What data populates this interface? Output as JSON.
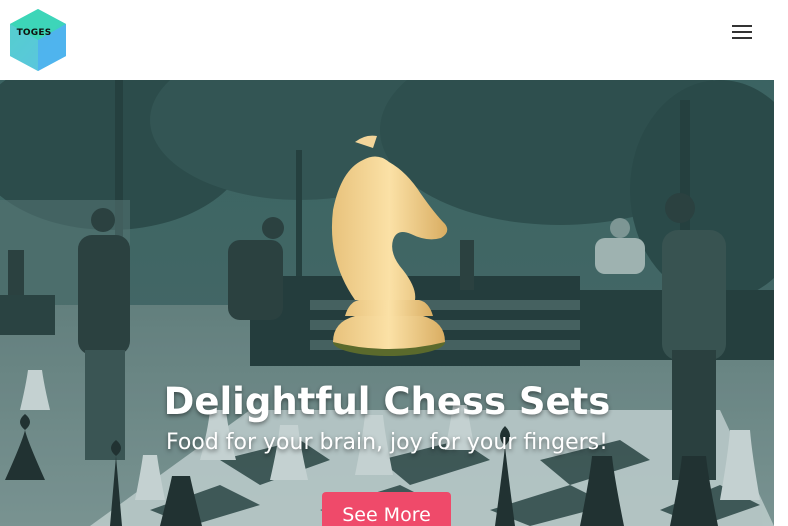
{
  "brand": {
    "name": "TOGES",
    "colors": {
      "logo_teal": "#42d6c4",
      "logo_blue": "#4aa6e8",
      "accent": "#ef4a6a"
    }
  },
  "header": {
    "menu_icon": "hamburger-menu-icon"
  },
  "hero": {
    "title": "Delightful Chess Sets",
    "subtitle": "Food for your brain, joy for your fingers!",
    "cta_label": "See More",
    "overlay_color": "#2e5a58"
  }
}
